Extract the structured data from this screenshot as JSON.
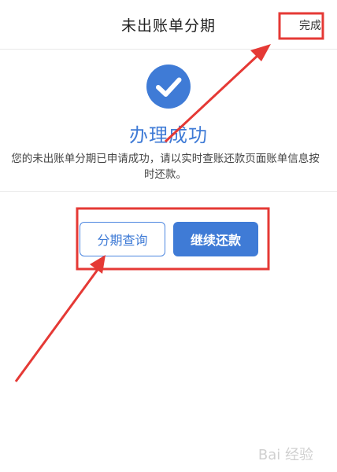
{
  "nav": {
    "title": "未出账单分期",
    "done_label": "完成"
  },
  "success": {
    "title": "办理成功",
    "description": "您的未出账单分期已申请成功，请以实时查账还款页面账单信息按时还款。"
  },
  "buttons": {
    "query_label": "分期查询",
    "continue_label": "继续还款"
  },
  "colors": {
    "accent": "#3f7bd6",
    "annotation": "#e53935"
  },
  "icons": {
    "status": "check-icon"
  },
  "watermark": {
    "text": "Bai 经验"
  }
}
